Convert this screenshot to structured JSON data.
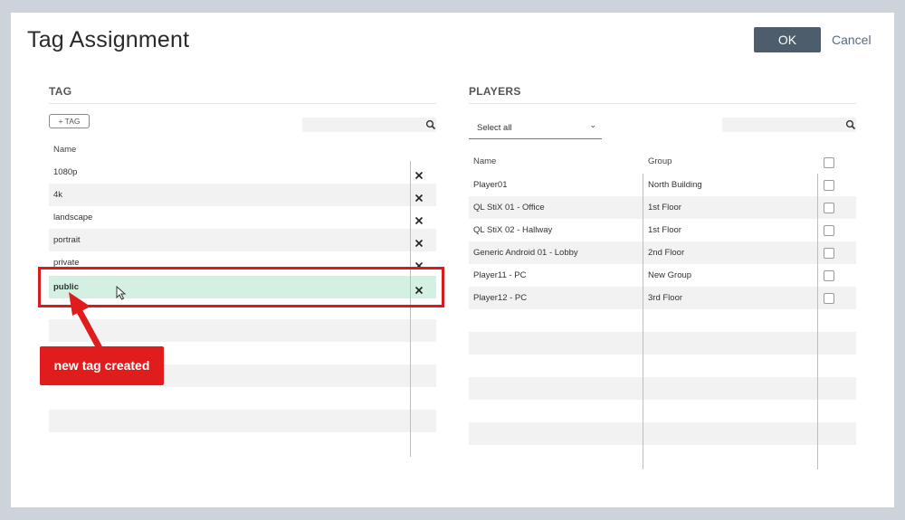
{
  "dialog": {
    "title": "Tag Assignment",
    "ok_label": "OK",
    "cancel_label": "Cancel"
  },
  "tag_panel": {
    "header": "TAG",
    "add_button": "+ TAG",
    "column_name": "Name",
    "rows": [
      "1080p",
      "4k",
      "landscape",
      "portrait",
      "private",
      "public"
    ],
    "selected": "public"
  },
  "players_panel": {
    "header": "PLAYERS",
    "select_all": "Select all",
    "columns": {
      "name": "Name",
      "group": "Group"
    },
    "rows": [
      {
        "name": "Player01",
        "group": "North Building",
        "checked": false
      },
      {
        "name": "QL StiX 01 - Office",
        "group": "1st Floor",
        "checked": false
      },
      {
        "name": "QL StiX 02 - Hallway",
        "group": "1st Floor",
        "checked": false
      },
      {
        "name": "Generic Android 01 - Lobby",
        "group": "2nd Floor",
        "checked": false
      },
      {
        "name": "Player11 - PC",
        "group": "New Group",
        "checked": false
      },
      {
        "name": "Player12 - PC",
        "group": "3rd Floor",
        "checked": false
      }
    ]
  },
  "annotation": {
    "callout_text": "new tag created",
    "color": "#e11c1c"
  },
  "colors": {
    "ok_button": "#4d5d6c",
    "selected_row": "#d3f0e3",
    "stripe": "#f2f2f2",
    "backdrop": "#cdd3db"
  }
}
